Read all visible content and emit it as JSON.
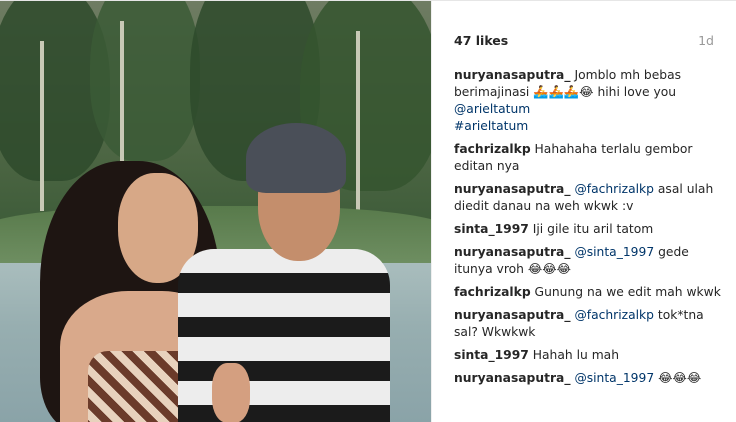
{
  "post": {
    "likes": "47 likes",
    "age": "1d"
  },
  "comments": [
    {
      "user": "nuryanasaputra_",
      "parts": [
        "Jomblo mh bebas berimajinasi 🚣🚣🚣😂 hihi love you"
      ],
      "mention": "@arieltatum",
      "tag": "#arieltatum"
    },
    {
      "user": "fachrizalkp",
      "text": "Hahahaha terlalu gembor editan nya"
    },
    {
      "user": "nuryanasaputra_",
      "mention": "@fachrizalkp",
      "text": "asal ulah diedit danau na weh wkwk :v"
    },
    {
      "user": "sinta_1997",
      "text": "Iji gile itu aril tatom"
    },
    {
      "user": "nuryanasaputra_",
      "mention": "@sinta_1997",
      "text": "gede itunya vroh 😂😂😂"
    },
    {
      "user": "fachrizalkp",
      "text": "Gunung na we edit mah wkwk"
    },
    {
      "user": "nuryanasaputra_",
      "mention": "@fachrizalkp",
      "text": "tok*tna sal? Wkwkwk"
    },
    {
      "user": "sinta_1997",
      "text": "Hahah lu mah"
    },
    {
      "user": "nuryanasaputra_",
      "mention": "@sinta_1997",
      "text": "😂😂😂"
    }
  ]
}
